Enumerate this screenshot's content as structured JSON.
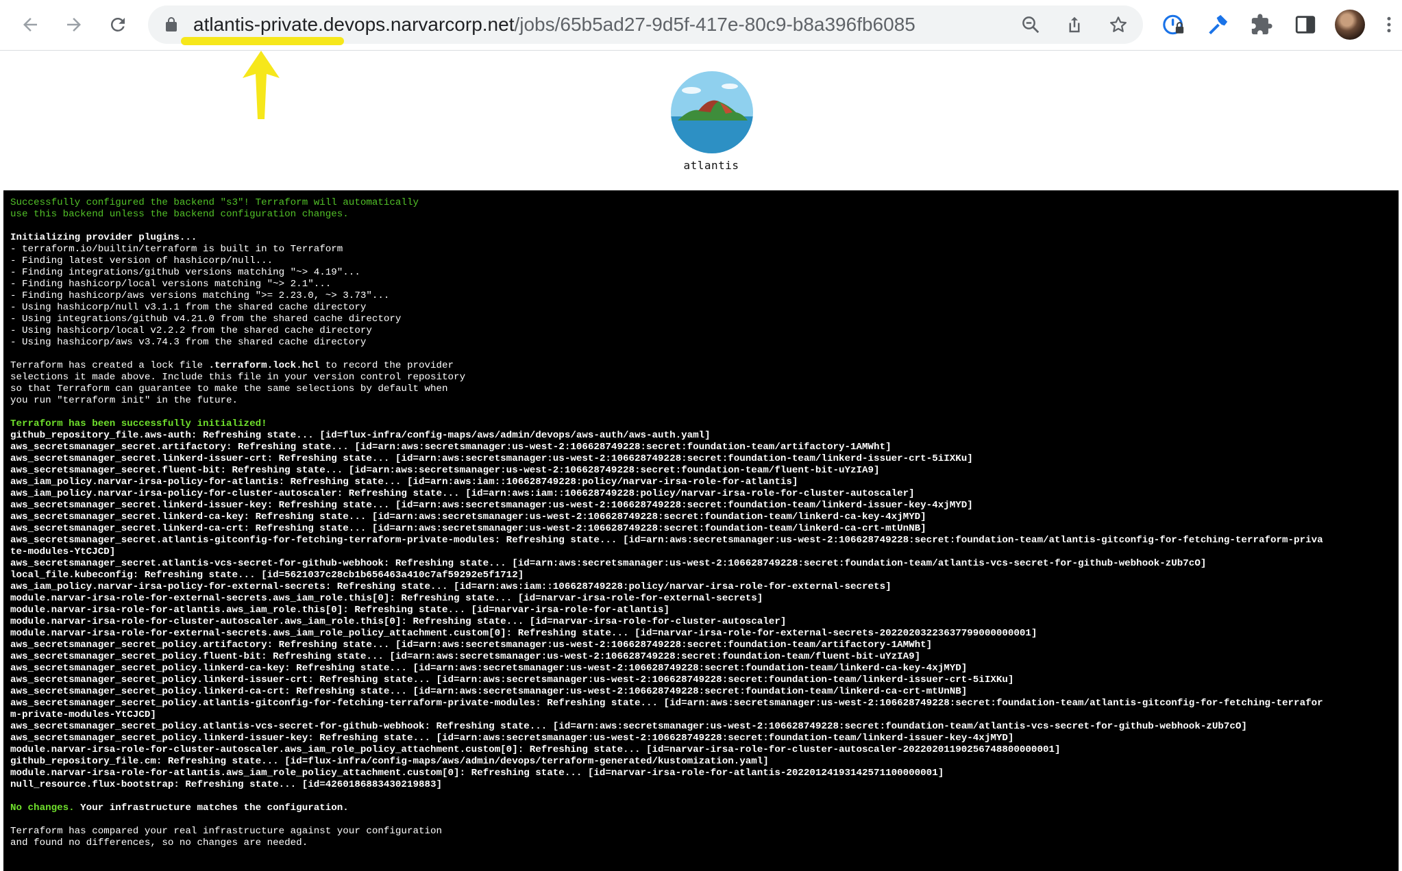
{
  "browser": {
    "url_host": "atlantis-private.devops.narvarcorp.net",
    "url_path": "/jobs/65b5ad27-9d5f-417e-80c9-b8a396fb6085",
    "highlight_color": "#f6e71b"
  },
  "app": {
    "logo_name": "atlantis"
  },
  "terminal": {
    "backend_msg": [
      "Successfully configured the backend \"s3\"! Terraform will automatically",
      "use this backend unless the backend configuration changes."
    ],
    "init_heading": "Initializing provider plugins...",
    "init_lines": [
      "- terraform.io/builtin/terraform is built in to Terraform",
      "- Finding latest version of hashicorp/null...",
      "- Finding integrations/github versions matching \"~> 4.19\"...",
      "- Finding hashicorp/local versions matching \"~> 2.1\"...",
      "- Finding hashicorp/aws versions matching \">= 2.23.0, ~> 3.73\"...",
      "- Using hashicorp/null v3.1.1 from the shared cache directory",
      "- Using integrations/github v4.21.0 from the shared cache directory",
      "- Using hashicorp/local v2.2.2 from the shared cache directory",
      "- Using hashicorp/aws v3.74.3 from the shared cache directory"
    ],
    "lock_pre": "Terraform has created a lock file ",
    "lock_file": ".terraform.lock.hcl",
    "lock_post": " to record the provider",
    "lock_lines": [
      "selections it made above. Include this file in your version control repository",
      "so that Terraform can guarantee to make the same selections by default when",
      "you run \"terraform init\" in the future."
    ],
    "init_success": "Terraform has been successfully initialized!",
    "refresh_lines": [
      "github_repository_file.aws-auth: Refreshing state... [id=flux-infra/config-maps/aws/admin/devops/aws-auth/aws-auth.yaml]",
      "aws_secretsmanager_secret.artifactory: Refreshing state... [id=arn:aws:secretsmanager:us-west-2:106628749228:secret:foundation-team/artifactory-1AMWht]",
      "aws_secretsmanager_secret.linkerd-issuer-crt: Refreshing state... [id=arn:aws:secretsmanager:us-west-2:106628749228:secret:foundation-team/linkerd-issuer-crt-5iIXKu]",
      "aws_secretsmanager_secret.fluent-bit: Refreshing state... [id=arn:aws:secretsmanager:us-west-2:106628749228:secret:foundation-team/fluent-bit-uYzIA9]",
      "aws_iam_policy.narvar-irsa-policy-for-atlantis: Refreshing state... [id=arn:aws:iam::106628749228:policy/narvar-irsa-role-for-atlantis]",
      "aws_iam_policy.narvar-irsa-policy-for-cluster-autoscaler: Refreshing state... [id=arn:aws:iam::106628749228:policy/narvar-irsa-role-for-cluster-autoscaler]",
      "aws_secretsmanager_secret.linkerd-issuer-key: Refreshing state... [id=arn:aws:secretsmanager:us-west-2:106628749228:secret:foundation-team/linkerd-issuer-key-4xjMYD]",
      "aws_secretsmanager_secret.linkerd-ca-key: Refreshing state... [id=arn:aws:secretsmanager:us-west-2:106628749228:secret:foundation-team/linkerd-ca-key-4xjMYD]",
      "aws_secretsmanager_secret.linkerd-ca-crt: Refreshing state... [id=arn:aws:secretsmanager:us-west-2:106628749228:secret:foundation-team/linkerd-ca-crt-mtUnNB]",
      "aws_secretsmanager_secret.atlantis-gitconfig-for-fetching-terraform-private-modules: Refreshing state... [id=arn:aws:secretsmanager:us-west-2:106628749228:secret:foundation-team/atlantis-gitconfig-for-fetching-terraform-priva",
      "te-modules-YtCJCD]",
      "aws_secretsmanager_secret.atlantis-vcs-secret-for-github-webhook: Refreshing state... [id=arn:aws:secretsmanager:us-west-2:106628749228:secret:foundation-team/atlantis-vcs-secret-for-github-webhook-zUb7cO]",
      "local_file.kubeconfig: Refreshing state... [id=5621037c28cb1b656463a410c7af59292e5f1712]",
      "aws_iam_policy.narvar-irsa-policy-for-external-secrets: Refreshing state... [id=arn:aws:iam::106628749228:policy/narvar-irsa-role-for-external-secrets]",
      "module.narvar-irsa-role-for-external-secrets.aws_iam_role.this[0]: Refreshing state... [id=narvar-irsa-role-for-external-secrets]",
      "module.narvar-irsa-role-for-atlantis.aws_iam_role.this[0]: Refreshing state... [id=narvar-irsa-role-for-atlantis]",
      "module.narvar-irsa-role-for-cluster-autoscaler.aws_iam_role.this[0]: Refreshing state... [id=narvar-irsa-role-for-cluster-autoscaler]",
      "module.narvar-irsa-role-for-external-secrets.aws_iam_role_policy_attachment.custom[0]: Refreshing state... [id=narvar-irsa-role-for-external-secrets-20220203223637799000000001]",
      "aws_secretsmanager_secret_policy.artifactory: Refreshing state... [id=arn:aws:secretsmanager:us-west-2:106628749228:secret:foundation-team/artifactory-1AMWht]",
      "aws_secretsmanager_secret_policy.fluent-bit: Refreshing state... [id=arn:aws:secretsmanager:us-west-2:106628749228:secret:foundation-team/fluent-bit-uYzIA9]",
      "aws_secretsmanager_secret_policy.linkerd-ca-key: Refreshing state... [id=arn:aws:secretsmanager:us-west-2:106628749228:secret:foundation-team/linkerd-ca-key-4xjMYD]",
      "aws_secretsmanager_secret_policy.linkerd-issuer-crt: Refreshing state... [id=arn:aws:secretsmanager:us-west-2:106628749228:secret:foundation-team/linkerd-issuer-crt-5iIXKu]",
      "aws_secretsmanager_secret_policy.linkerd-ca-crt: Refreshing state... [id=arn:aws:secretsmanager:us-west-2:106628749228:secret:foundation-team/linkerd-ca-crt-mtUnNB]",
      "aws_secretsmanager_secret_policy.atlantis-gitconfig-for-fetching-terraform-private-modules: Refreshing state... [id=arn:aws:secretsmanager:us-west-2:106628749228:secret:foundation-team/atlantis-gitconfig-for-fetching-terrafor",
      "m-private-modules-YtCJCD]",
      "aws_secretsmanager_secret_policy.atlantis-vcs-secret-for-github-webhook: Refreshing state... [id=arn:aws:secretsmanager:us-west-2:106628749228:secret:foundation-team/atlantis-vcs-secret-for-github-webhook-zUb7cO]",
      "aws_secretsmanager_secret_policy.linkerd-issuer-key: Refreshing state... [id=arn:aws:secretsmanager:us-west-2:106628749228:secret:foundation-team/linkerd-issuer-key-4xjMYD]",
      "module.narvar-irsa-role-for-cluster-autoscaler.aws_iam_role_policy_attachment.custom[0]: Refreshing state... [id=narvar-irsa-role-for-cluster-autoscaler-20220201190256748800000001]",
      "github_repository_file.cm: Refreshing state... [id=flux-infra/config-maps/aws/admin/devops/terraform-generated/kustomization.yaml]",
      "module.narvar-irsa-role-for-atlantis.aws_iam_role_policy_attachment.custom[0]: Refreshing state... [id=narvar-irsa-role-for-atlantis-20220124193142571100000001]",
      "null_resource.flux-bootstrap: Refreshing state... [id=4260186883430219883]"
    ],
    "no_changes_label": "No changes.",
    "no_changes_msg": " Your infrastructure matches the configuration.",
    "final_lines": [
      "Terraform has compared your real infrastructure against your configuration",
      "and found no differences, so no changes are needed."
    ]
  }
}
